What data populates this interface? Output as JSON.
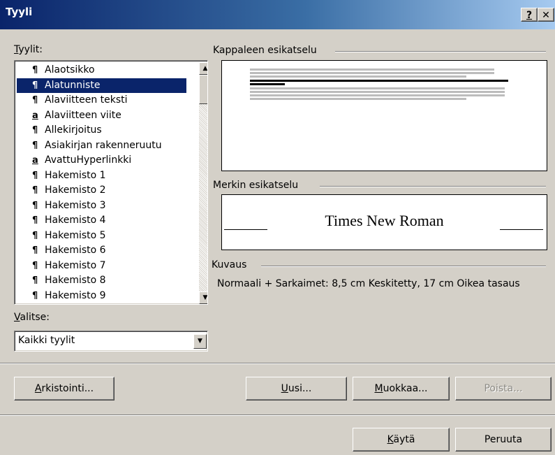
{
  "window": {
    "title": "Tyyli",
    "help_btn": "?",
    "close_btn": "✕"
  },
  "styles_label": {
    "pre": "",
    "acc": "T",
    "post": "yylit:"
  },
  "styles": [
    {
      "glyph": "¶",
      "label": "Alaotsikko",
      "selected": false
    },
    {
      "glyph": "¶",
      "label": "Alatunniste",
      "selected": true
    },
    {
      "glyph": "¶",
      "label": "Alaviitteen teksti",
      "selected": false
    },
    {
      "glyph": "a",
      "label": "Alaviitteen viite",
      "selected": false
    },
    {
      "glyph": "¶",
      "label": "Allekirjoitus",
      "selected": false
    },
    {
      "glyph": "¶",
      "label": "Asiakirjan rakenneruutu",
      "selected": false
    },
    {
      "glyph": "a",
      "label": "AvattuHyperlinkki",
      "selected": false
    },
    {
      "glyph": "¶",
      "label": "Hakemisto 1",
      "selected": false
    },
    {
      "glyph": "¶",
      "label": "Hakemisto 2",
      "selected": false
    },
    {
      "glyph": "¶",
      "label": "Hakemisto 3",
      "selected": false
    },
    {
      "glyph": "¶",
      "label": "Hakemisto 4",
      "selected": false
    },
    {
      "glyph": "¶",
      "label": "Hakemisto 5",
      "selected": false
    },
    {
      "glyph": "¶",
      "label": "Hakemisto 6",
      "selected": false
    },
    {
      "glyph": "¶",
      "label": "Hakemisto 7",
      "selected": false
    },
    {
      "glyph": "¶",
      "label": "Hakemisto 8",
      "selected": false
    },
    {
      "glyph": "¶",
      "label": "Hakemisto 9",
      "selected": false
    }
  ],
  "select_label": {
    "acc": "V",
    "post": "alitse:"
  },
  "select_value": "Kaikki tyylit",
  "paragraph_preview_label": "Kappaleen esikatselu",
  "char_preview_label": "Merkin esikatselu",
  "char_preview_font": "Times New Roman",
  "description_label": "Kuvaus",
  "description_text": "Normaali + Sarkaimet: 8,5 cm Keskitetty, 17 cm Oikea tasaus",
  "buttons": {
    "organizer": {
      "acc": "A",
      "post": "rkistointi..."
    },
    "new": {
      "acc": "U",
      "post": "usi..."
    },
    "modify": {
      "acc": "M",
      "post": "uokkaa..."
    },
    "delete": "Poista...",
    "apply": {
      "acc": "K",
      "post": "äytä"
    },
    "cancel": "Peruuta"
  },
  "icons": {
    "scroll_up": "up-arrow-icon",
    "scroll_down": "down-arrow-icon",
    "dropdown": "chevron-down-icon",
    "paragraph": "pilcrow-icon",
    "character": "char-style-icon"
  }
}
